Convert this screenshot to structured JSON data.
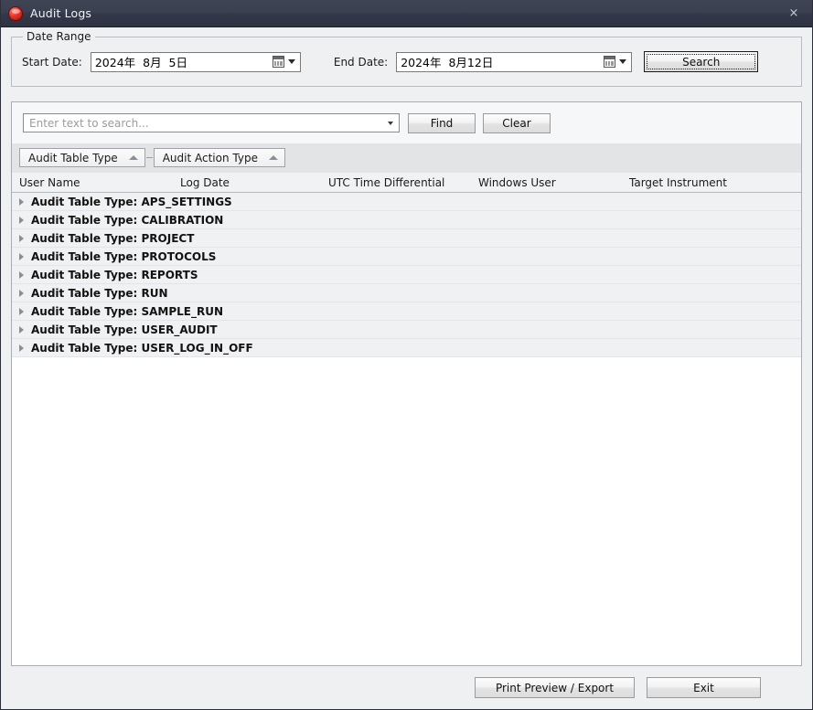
{
  "window": {
    "title": "Audit Logs",
    "app_icon": "red-sphere-icon",
    "close_label": "×"
  },
  "date_range": {
    "legend": "Date Range",
    "start_label": "Start Date:",
    "start_value": "2024年  8月  5日",
    "end_label": "End Date:",
    "end_value": "2024年  8月12日",
    "search_label": "Search"
  },
  "search": {
    "placeholder": "Enter text to search...",
    "value": "",
    "find_label": "Find",
    "clear_label": "Clear"
  },
  "group_by": {
    "chips": [
      {
        "label": "Audit Table Type",
        "sort": "ascending"
      },
      {
        "label": "Audit Action Type",
        "sort": "ascending"
      }
    ]
  },
  "grid": {
    "columns": [
      "User Name",
      "Log Date",
      "UTC Time Differential",
      "Windows User",
      "Target Instrument"
    ],
    "group_rows": [
      {
        "label": "Audit Table Type: APS_SETTINGS",
        "expanded": false
      },
      {
        "label": "Audit Table Type: CALIBRATION",
        "expanded": false
      },
      {
        "label": "Audit Table Type: PROJECT",
        "expanded": false
      },
      {
        "label": "Audit Table Type: PROTOCOLS",
        "expanded": false
      },
      {
        "label": "Audit Table Type: REPORTS",
        "expanded": false
      },
      {
        "label": "Audit Table Type: RUN",
        "expanded": false
      },
      {
        "label": "Audit Table Type: SAMPLE_RUN",
        "expanded": false
      },
      {
        "label": "Audit Table Type: USER_AUDIT",
        "expanded": false
      },
      {
        "label": "Audit Table Type: USER_LOG_IN_OFF",
        "expanded": false
      }
    ]
  },
  "footer": {
    "print_label": "Print Preview / Export",
    "exit_label": "Exit"
  },
  "colors": {
    "titlebar": "#3b4050",
    "dialog_bg": "#eef0f2",
    "panel_bg": "#fdfdfd",
    "group_row_bg": "#f0f1f3",
    "groupby_band": "#e2e4e6",
    "accent_icon": "#e8372b"
  }
}
